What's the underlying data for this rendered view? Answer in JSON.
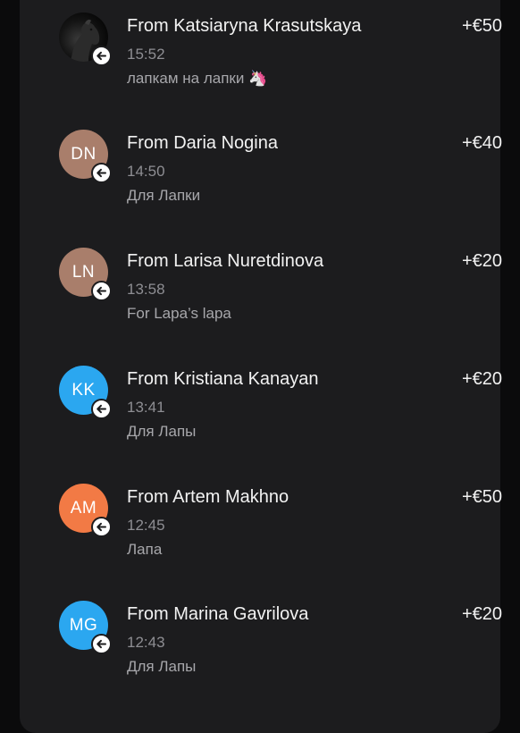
{
  "transactions": [
    {
      "initials": "",
      "avatar_type": "photo",
      "avatar_color": "#000000",
      "badge_icon": "arrow-left-icon",
      "title": "From Katsiaryna Krasutskaya",
      "time": "15:52",
      "note": "лапкам на лапки 🦄",
      "amount": "+€50"
    },
    {
      "initials": "DN",
      "avatar_color": "#a97e6b",
      "badge_icon": "arrow-left-icon",
      "title": "From Daria Nogina",
      "time": "14:50",
      "note": "Для Лапки",
      "amount": "+€40"
    },
    {
      "initials": "LN",
      "avatar_color": "#a97e6b",
      "badge_icon": "arrow-left-icon",
      "title": "From Larisa Nuretdinova",
      "time": "13:58",
      "note": "For Lapa’s lapa",
      "amount": "+€20"
    },
    {
      "initials": "KK",
      "avatar_color": "#2ba7f0",
      "badge_icon": "arrow-left-icon",
      "title": "From Kristiana Kanayan",
      "time": "13:41",
      "note": "Для Лапы",
      "amount": "+€20"
    },
    {
      "initials": "AM",
      "avatar_color": "#f27a45",
      "badge_icon": "arrow-left-icon",
      "title": "From Artem Makhno",
      "time": "12:45",
      "note": "Лапа",
      "amount": "+€50"
    },
    {
      "initials": "MG",
      "avatar_color": "#2ba7f0",
      "badge_icon": "arrow-left-icon",
      "title": "From Marina Gavrilova",
      "time": "12:43",
      "note": "Для Лапы",
      "amount": "+€20"
    }
  ]
}
